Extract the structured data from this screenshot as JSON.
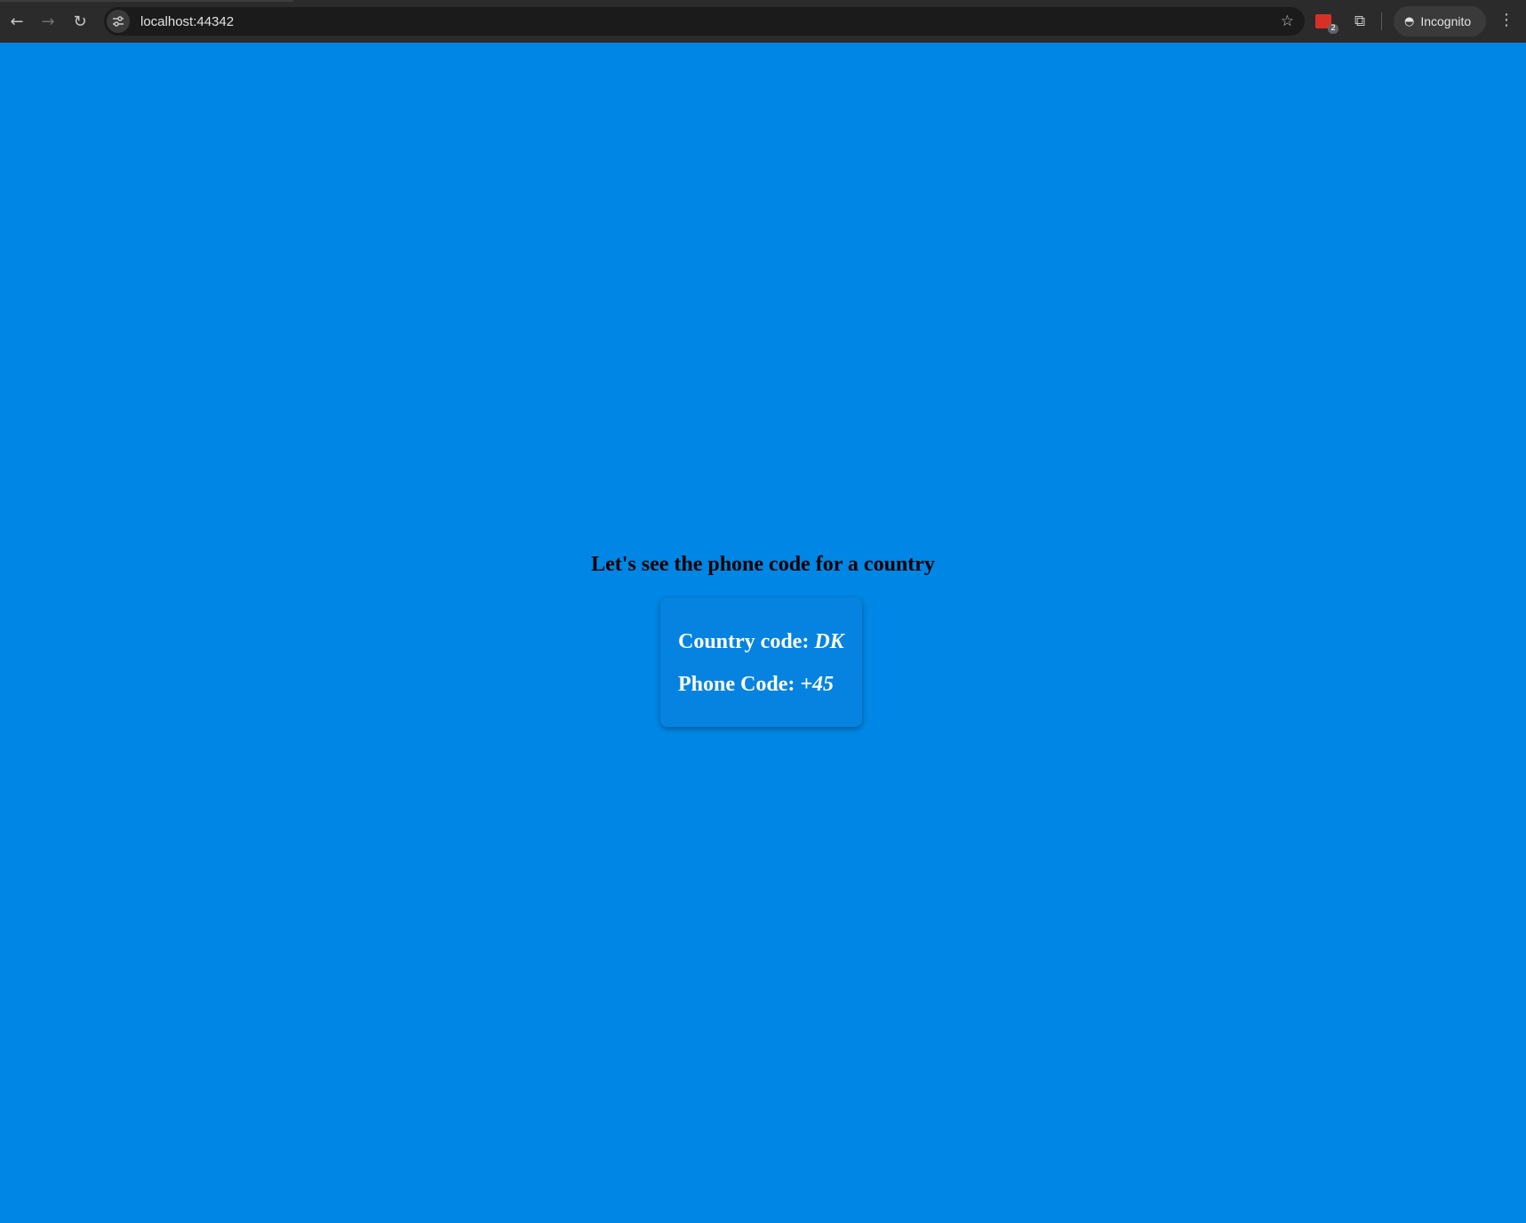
{
  "browser": {
    "url": "localhost:44342",
    "profile_label": "Incognito",
    "extension_badge_count": "2",
    "icons": {
      "back": "back-arrow-icon",
      "forward": "forward-arrow-icon",
      "reload": "reload-icon",
      "site_info": "tune-icon",
      "bookmark": "star-icon",
      "extension": "extension-icon",
      "extensions_menu": "puzzle-icon",
      "incognito": "incognito-icon",
      "menu": "kebab-menu-icon"
    }
  },
  "page": {
    "background_color": "#0086e4",
    "heading": "Let's see the phone code for a country",
    "card": {
      "country_label": "Country code:",
      "country_value": "DK",
      "phone_label": "Phone Code:",
      "phone_value": "+45"
    }
  }
}
